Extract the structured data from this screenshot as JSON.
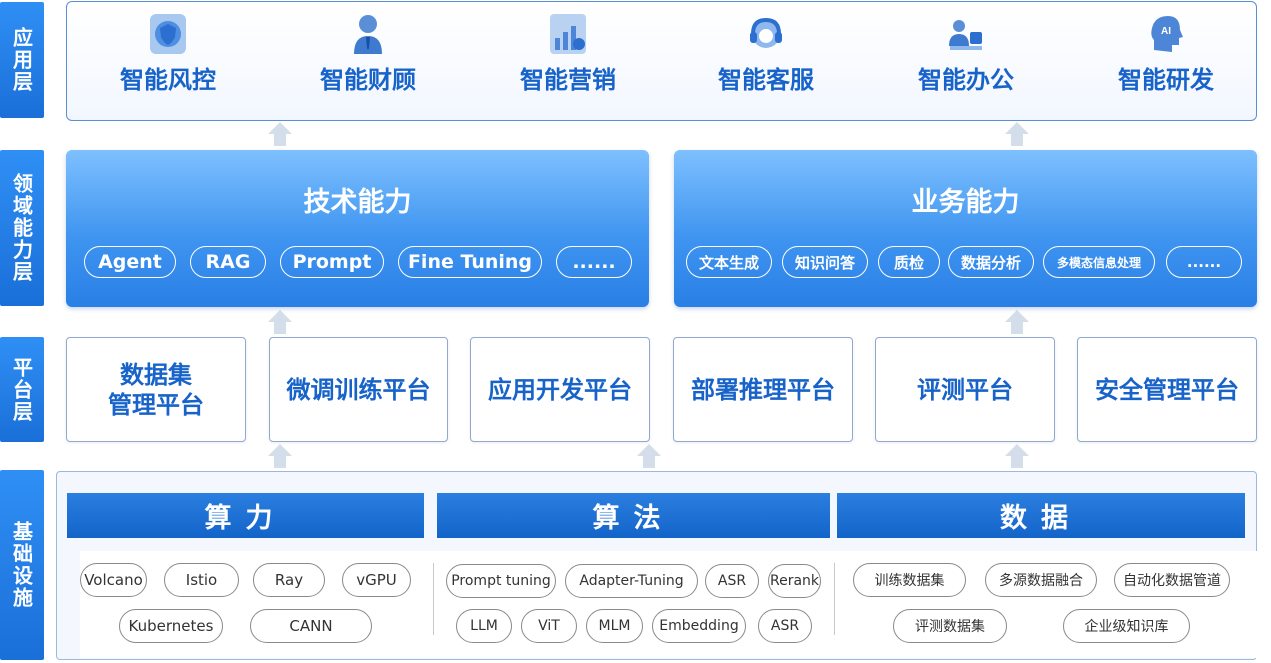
{
  "layers": {
    "application": "应用层",
    "domain": "领域能力层",
    "platform": "平台层",
    "infrastructure": "基础设施"
  },
  "application": {
    "items": [
      {
        "label": "智能风控",
        "icon": "risk-shield-icon"
      },
      {
        "label": "智能财顾",
        "icon": "advisor-person-icon"
      },
      {
        "label": "智能营销",
        "icon": "marketing-chart-icon"
      },
      {
        "label": "智能客服",
        "icon": "headset-icon"
      },
      {
        "label": "智能办公",
        "icon": "office-people-icon"
      },
      {
        "label": "智能研发",
        "icon": "ai-head-icon"
      }
    ]
  },
  "domain": {
    "tech": {
      "title": "技术能力",
      "pills": [
        "Agent",
        "RAG",
        "Prompt",
        "Fine Tuning",
        "......"
      ]
    },
    "business": {
      "title": "业务能力",
      "pills": [
        "文本生成",
        "知识问答",
        "质检",
        "数据分析",
        "多模态信息处理",
        "......"
      ]
    }
  },
  "platform": {
    "items": [
      "数据集\n管理平台",
      "微调训练平台",
      "应用开发平台",
      "部署推理平台",
      "评测平台",
      "安全管理平台"
    ]
  },
  "infrastructure": {
    "compute": {
      "title": "算力",
      "row1": [
        "Volcano",
        "Istio",
        "Ray",
        "vGPU"
      ],
      "row2": [
        "Kubernetes",
        "CANN"
      ]
    },
    "algorithm": {
      "title": "算法",
      "row1": [
        "Prompt tuning",
        "Adapter-Tuning",
        "ASR",
        "Rerank"
      ],
      "row2": [
        "LLM",
        "ViT",
        "MLM",
        "Embedding",
        "ASR"
      ]
    },
    "data": {
      "title": "数据",
      "row1": [
        "训练数据集",
        "多源数据融合",
        "自动化数据管道"
      ],
      "row2": [
        "评测数据集",
        "企业级知识库"
      ]
    }
  },
  "colors": {
    "primary": "#1763c9",
    "label_bg": "#2f8ff5",
    "panel_border": "#5b8fd3"
  }
}
